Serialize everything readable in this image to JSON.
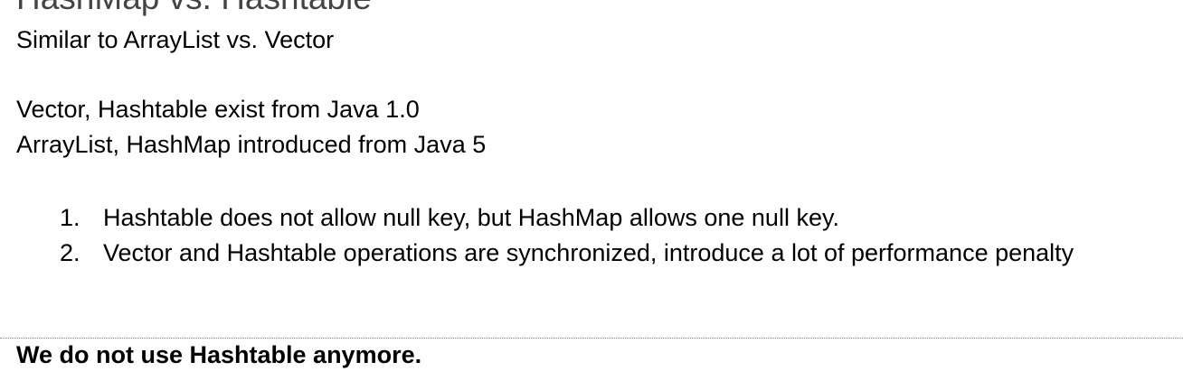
{
  "heading": "HashMap vs. Hashtable",
  "intro": "Similar to ArrayList vs. Vector",
  "history": [
    "Vector, Hashtable exist from Java 1.0",
    "ArrayList, HashMap introduced from Java 5"
  ],
  "differences": [
    {
      "num": "1.",
      "text": "Hashtable does not allow null key, but HashMap allows one null key."
    },
    {
      "num": "2.",
      "text": "Vector and Hashtable operations are synchronized, introduce a lot of performance penalty"
    }
  ],
  "conclusion": "We do not use Hashtable anymore."
}
